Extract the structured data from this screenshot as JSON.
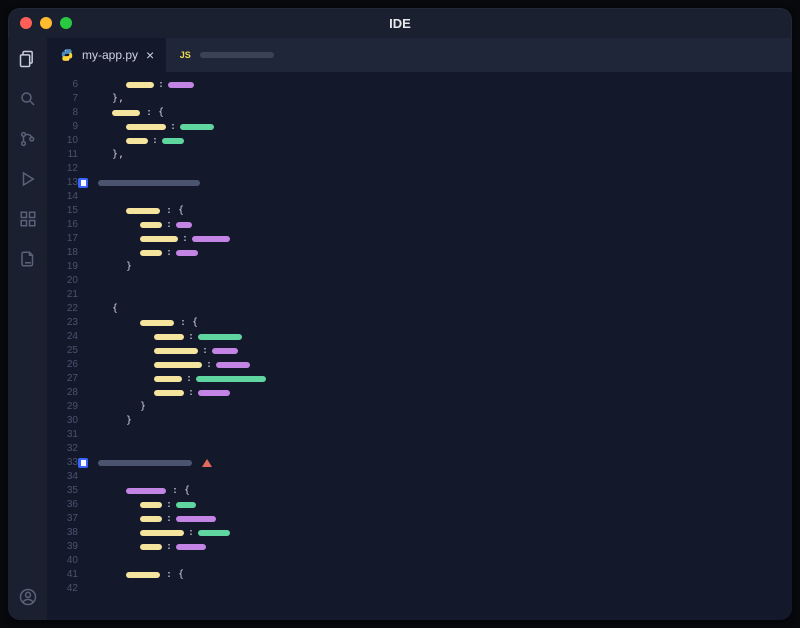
{
  "window": {
    "title": "IDE"
  },
  "tabs": [
    {
      "label": "my-app.py",
      "filetype": "py",
      "active": true,
      "closeable": true
    },
    {
      "label": "",
      "filetype": "js",
      "active": false,
      "placeholder_width": 74
    }
  ],
  "activity_icons": [
    "files",
    "search",
    "source-control",
    "run",
    "extensions",
    "export"
  ],
  "colors": {
    "bg_window": "#1b2030",
    "bg_editor": "#13182a",
    "bg_tabbar": "#20263a",
    "token_key": "#f5e49e",
    "token_string_purple": "#c484e6",
    "token_string_green": "#5fd6a0",
    "comment": "#4a546e",
    "accent_badge": "#3a66ff",
    "warning": "#e06b5d"
  },
  "gutter": {
    "start": 6,
    "end": 42
  },
  "code_lines": [
    {
      "n": 6,
      "indent": 2,
      "tokens": [
        [
          "y",
          28
        ],
        [
          ":"
        ],
        [
          "p",
          26
        ]
      ]
    },
    {
      "n": 7,
      "indent": 1,
      "tokens": [
        [
          "brace",
          "},"
        ]
      ]
    },
    {
      "n": 8,
      "indent": 1,
      "tokens": [
        [
          "y",
          28
        ],
        [
          ": {"
        ]
      ]
    },
    {
      "n": 9,
      "indent": 2,
      "tokens": [
        [
          "y",
          40
        ],
        [
          ":"
        ],
        [
          "g",
          34
        ]
      ]
    },
    {
      "n": 10,
      "indent": 2,
      "tokens": [
        [
          "y",
          22
        ],
        [
          ":"
        ],
        [
          "g",
          22
        ]
      ]
    },
    {
      "n": 11,
      "indent": 1,
      "tokens": [
        [
          "brace",
          "},"
        ]
      ]
    },
    {
      "n": 12,
      "indent": 0,
      "tokens": []
    },
    {
      "n": 13,
      "indent": 0,
      "badge": true,
      "tokens": [
        [
          "c",
          102
        ]
      ]
    },
    {
      "n": 14,
      "indent": 0,
      "tokens": []
    },
    {
      "n": 15,
      "indent": 2,
      "tokens": [
        [
          "y",
          34
        ],
        [
          ": {"
        ]
      ]
    },
    {
      "n": 16,
      "indent": 3,
      "tokens": [
        [
          "y",
          22
        ],
        [
          ":"
        ],
        [
          "p",
          16
        ]
      ]
    },
    {
      "n": 17,
      "indent": 3,
      "tokens": [
        [
          "y",
          38
        ],
        [
          ":"
        ],
        [
          "p",
          38
        ]
      ]
    },
    {
      "n": 18,
      "indent": 3,
      "tokens": [
        [
          "y",
          22
        ],
        [
          ":"
        ],
        [
          "p",
          22
        ]
      ]
    },
    {
      "n": 19,
      "indent": 2,
      "tokens": [
        [
          "brace",
          "}"
        ]
      ]
    },
    {
      "n": 20,
      "indent": 1,
      "tokens": []
    },
    {
      "n": 21,
      "indent": 1,
      "tokens": []
    },
    {
      "n": 22,
      "indent": 1,
      "tokens": [
        [
          "brace",
          "{"
        ]
      ]
    },
    {
      "n": 23,
      "indent": 3,
      "tokens": [
        [
          "y",
          34
        ],
        [
          ": {"
        ]
      ]
    },
    {
      "n": 24,
      "indent": 4,
      "tokens": [
        [
          "y",
          30
        ],
        [
          ":"
        ],
        [
          "g",
          44
        ]
      ]
    },
    {
      "n": 25,
      "indent": 4,
      "tokens": [
        [
          "y",
          44
        ],
        [
          ":"
        ],
        [
          "p",
          26
        ]
      ]
    },
    {
      "n": 26,
      "indent": 4,
      "tokens": [
        [
          "y",
          48
        ],
        [
          ":"
        ],
        [
          "p",
          34
        ]
      ]
    },
    {
      "n": 27,
      "indent": 4,
      "tokens": [
        [
          "y",
          28
        ],
        [
          ":"
        ],
        [
          "g",
          70
        ]
      ]
    },
    {
      "n": 28,
      "indent": 4,
      "tokens": [
        [
          "y",
          30
        ],
        [
          ":"
        ],
        [
          "p",
          32
        ]
      ]
    },
    {
      "n": 29,
      "indent": 3,
      "tokens": [
        [
          "brace",
          "}"
        ]
      ]
    },
    {
      "n": 30,
      "indent": 2,
      "tokens": [
        [
          "brace",
          "}"
        ]
      ]
    },
    {
      "n": 31,
      "indent": 0,
      "tokens": []
    },
    {
      "n": 32,
      "indent": 0,
      "tokens": []
    },
    {
      "n": 33,
      "indent": 0,
      "badge": true,
      "highlight": true,
      "warning": true,
      "tokens": [
        [
          "c",
          94
        ]
      ]
    },
    {
      "n": 34,
      "indent": 0,
      "tokens": []
    },
    {
      "n": 35,
      "indent": 2,
      "tokens": [
        [
          "p",
          40
        ],
        [
          ": {"
        ]
      ]
    },
    {
      "n": 36,
      "indent": 3,
      "tokens": [
        [
          "y",
          22
        ],
        [
          ":"
        ],
        [
          "g",
          20
        ]
      ]
    },
    {
      "n": 37,
      "indent": 3,
      "tokens": [
        [
          "y",
          22
        ],
        [
          ":"
        ],
        [
          "p",
          40
        ]
      ]
    },
    {
      "n": 38,
      "indent": 3,
      "tokens": [
        [
          "y",
          44
        ],
        [
          ":"
        ],
        [
          "g",
          32
        ]
      ]
    },
    {
      "n": 39,
      "indent": 3,
      "tokens": [
        [
          "y",
          22
        ],
        [
          ":"
        ],
        [
          "p",
          30
        ]
      ]
    },
    {
      "n": 40,
      "indent": 2,
      "tokens": []
    },
    {
      "n": 41,
      "indent": 2,
      "tokens": [
        [
          "y",
          34
        ],
        [
          ": {"
        ]
      ]
    },
    {
      "n": 42,
      "indent": 3,
      "tokens": []
    }
  ]
}
